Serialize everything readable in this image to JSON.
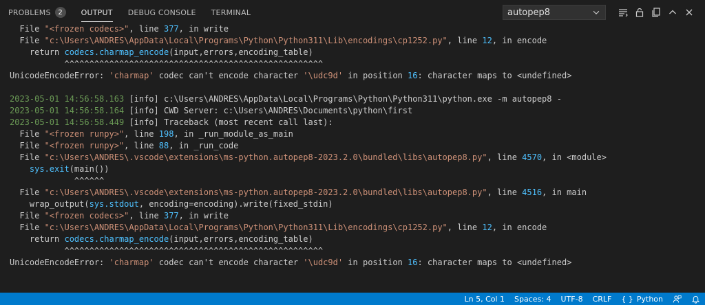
{
  "panel": {
    "tabs": [
      {
        "label": "PROBLEMS",
        "badge": "2"
      },
      {
        "label": "OUTPUT"
      },
      {
        "label": "DEBUG CONSOLE"
      },
      {
        "label": "TERMINAL"
      }
    ],
    "channel": "autopep8",
    "icons": [
      "list-filter-icon",
      "lock-icon",
      "copy-icon",
      "chevron-up-icon",
      "close-icon"
    ]
  },
  "output": {
    "lines": [
      [
        {
          "t": "  File "
        },
        {
          "t": "\"<frozen codecs>\"",
          "c": "str"
        },
        {
          "t": ", line "
        },
        {
          "t": "377",
          "c": "ln"
        },
        {
          "t": ", in write"
        }
      ],
      [
        {
          "t": "  File "
        },
        {
          "t": "\"c:\\Users\\ANDRES\\AppData\\Local\\Programs\\Python\\Python311\\Lib\\encodings\\cp1252.py\"",
          "c": "str"
        },
        {
          "t": ", line "
        },
        {
          "t": "12",
          "c": "ln"
        },
        {
          "t": ", in encode"
        }
      ],
      [
        {
          "t": "    return "
        },
        {
          "t": "codecs.charmap_encode",
          "c": "fn"
        },
        {
          "t": "(input,errors,encoding_table)"
        }
      ],
      [
        {
          "t": "           ^^^^^^^^^^^^^^^^^^^^^^^^^^^^^^^^^^^^^^^^^^^^^^^^^^^^"
        }
      ],
      [
        {
          "t": "UnicodeEncodeError: "
        },
        {
          "t": "'charmap'",
          "c": "str"
        },
        {
          "t": " codec can't encode character "
        },
        {
          "t": "'\\udc9d'",
          "c": "str"
        },
        {
          "t": " in position "
        },
        {
          "t": "16",
          "c": "ln"
        },
        {
          "t": ": character maps to <undefined>"
        }
      ],
      [
        {
          "t": ""
        }
      ],
      [
        {
          "t": "2023-05-01 14:56:58.163",
          "c": "dt"
        },
        {
          "t": " [info] c:\\Users\\ANDRES\\AppData\\Local\\Programs\\Python\\Python311\\python.exe -m autopep8 -"
        }
      ],
      [
        {
          "t": "2023-05-01 14:56:58.164",
          "c": "dt"
        },
        {
          "t": " [info] CWD Server: c:\\Users\\ANDRES\\Documents\\python\\first"
        }
      ],
      [
        {
          "t": "2023-05-01 14:56:58.449",
          "c": "dt"
        },
        {
          "t": " [info] Traceback (most recent call last):"
        }
      ],
      [
        {
          "t": "  File "
        },
        {
          "t": "\"<frozen runpy>\"",
          "c": "str"
        },
        {
          "t": ", line "
        },
        {
          "t": "198",
          "c": "ln"
        },
        {
          "t": ", in _run_module_as_main"
        }
      ],
      [
        {
          "t": "  File "
        },
        {
          "t": "\"<frozen runpy>\"",
          "c": "str"
        },
        {
          "t": ", line "
        },
        {
          "t": "88",
          "c": "ln"
        },
        {
          "t": ", in _run_code"
        }
      ],
      [
        {
          "t": "  File "
        },
        {
          "t": "\"c:\\Users\\ANDRES\\.vscode\\extensions\\ms-python.autopep8-2023.2.0\\bundled\\libs\\autopep8.py\"",
          "c": "str"
        },
        {
          "t": ", line "
        },
        {
          "t": "4570",
          "c": "ln"
        },
        {
          "t": ", in <module>"
        }
      ],
      [
        {
          "t": "    "
        },
        {
          "t": "sys.exit",
          "c": "fn"
        },
        {
          "t": "(main())"
        }
      ],
      [
        {
          "t": "             ^^^^^^"
        }
      ],
      [
        {
          "t": "  File "
        },
        {
          "t": "\"c:\\Users\\ANDRES\\.vscode\\extensions\\ms-python.autopep8-2023.2.0\\bundled\\libs\\autopep8.py\"",
          "c": "str"
        },
        {
          "t": ", line "
        },
        {
          "t": "4516",
          "c": "ln"
        },
        {
          "t": ", in main"
        }
      ],
      [
        {
          "t": "    wrap_output("
        },
        {
          "t": "sys.stdout",
          "c": "fn"
        },
        {
          "t": ", encoding=encoding).write(fixed_stdin)"
        }
      ],
      [
        {
          "t": "  File "
        },
        {
          "t": "\"<frozen codecs>\"",
          "c": "str"
        },
        {
          "t": ", line "
        },
        {
          "t": "377",
          "c": "ln"
        },
        {
          "t": ", in write"
        }
      ],
      [
        {
          "t": "  File "
        },
        {
          "t": "\"c:\\Users\\ANDRES\\AppData\\Local\\Programs\\Python\\Python311\\Lib\\encodings\\cp1252.py\"",
          "c": "str"
        },
        {
          "t": ", line "
        },
        {
          "t": "12",
          "c": "ln"
        },
        {
          "t": ", in encode"
        }
      ],
      [
        {
          "t": "    return "
        },
        {
          "t": "codecs.charmap_encode",
          "c": "fn"
        },
        {
          "t": "(input,errors,encoding_table)"
        }
      ],
      [
        {
          "t": "           ^^^^^^^^^^^^^^^^^^^^^^^^^^^^^^^^^^^^^^^^^^^^^^^^^^^^"
        }
      ],
      [
        {
          "t": "UnicodeEncodeError: "
        },
        {
          "t": "'charmap'",
          "c": "str"
        },
        {
          "t": " codec can't encode character "
        },
        {
          "t": "'\\udc9d'",
          "c": "str"
        },
        {
          "t": " in position "
        },
        {
          "t": "16",
          "c": "ln"
        },
        {
          "t": ": character maps to <undefined>"
        }
      ]
    ]
  },
  "statusbar": {
    "position": "Ln 5, Col 1",
    "spaces": "Spaces: 4",
    "encoding": "UTF-8",
    "eol": "CRLF",
    "language_braces": "{ }",
    "language": "Python"
  },
  "colors": {
    "background": "#1e1e1e",
    "statusbar": "#007acc",
    "string": "#ce9178",
    "number": "#4fc1ff",
    "timestamp": "#6a9955"
  }
}
